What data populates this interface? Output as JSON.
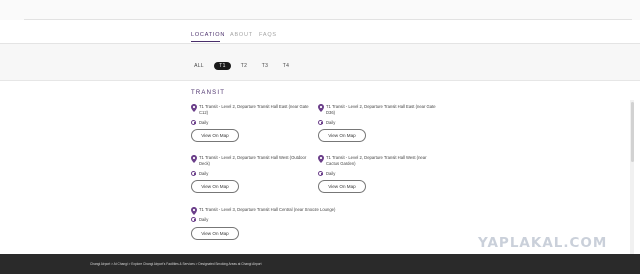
{
  "tabs": [
    "LOCATION",
    "ABOUT",
    "FAQS"
  ],
  "terminals": [
    "ALL",
    "T1",
    "T2",
    "T3",
    "T4"
  ],
  "section_title": "TRANSIT",
  "cards": [
    {
      "location": "T1 Transit - Level 2, Departure Transit Hall East (near Gate C12)",
      "hours": "Daily",
      "button": "View On Map"
    },
    {
      "location": "T1 Transit - Level 2, Departure Transit Hall East (near Gate D36)",
      "hours": "Daily",
      "button": "View On Map"
    },
    {
      "location": "T1 Transit - Level 2, Departure Transit Hall West (Outdoor Deck)",
      "hours": "Daily",
      "button": "View On Map"
    },
    {
      "location": "T1 Transit - Level 2, Departure Transit Hall West (near Cactus Garden)",
      "hours": "Daily",
      "button": "View On Map"
    },
    {
      "location": "T1 Transit - Level 3, Departure Transit Hall Central (near Snooze Lounge)",
      "hours": "Daily",
      "button": "View On Map"
    }
  ],
  "footer": {
    "breadcrumb": "Changi Airport > At Changi > Explore Changi Airport's Facilities & Services > Designated Smoking Areas at Changi Airport"
  },
  "watermark": "YAPLAKAL.COM",
  "colors": {
    "accent": "#4a2f6b",
    "footer_bg": "#2a2a2a",
    "pill_selected": "#1b1b1b"
  }
}
